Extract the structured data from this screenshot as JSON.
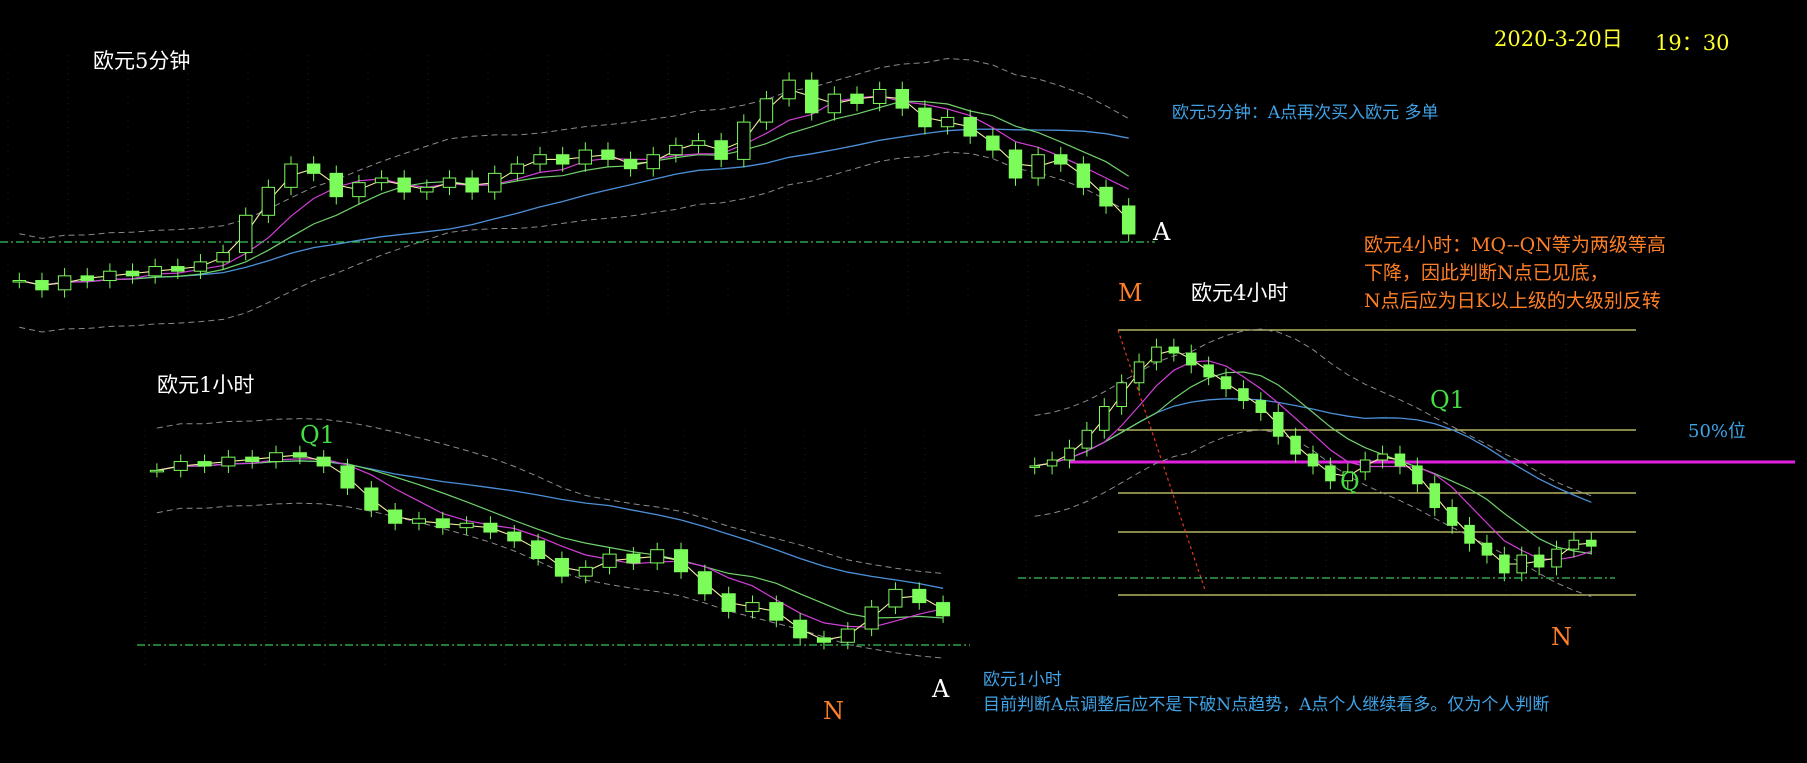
{
  "header": {
    "date": "2020-3-20日",
    "time": "19：30"
  },
  "panels": {
    "m5": {
      "title": "欧元5分钟",
      "note": "欧元5分钟：A点再次买入欧元 多单",
      "point_a": "A"
    },
    "h4": {
      "title": "欧元4小时",
      "note_lines": [
        "欧元4小时：MQ--QN等为两级等高",
        "下降，因此判断N点已见底，",
        "N点后应为日K以上级的大级别反转"
      ],
      "point_m": "M",
      "point_q1": "Q1",
      "point_q": "Q",
      "point_n": "N",
      "fib_label": "50%位"
    },
    "h1": {
      "title": "欧元1小时",
      "point_q1": "Q1",
      "point_n": "N",
      "point_a": "A",
      "note_title": "欧元1小时",
      "note_body": "目前判断A点调整后应不是下破N点趋势，A点个人继续看多。仅为个人判断"
    }
  },
  "colors": {
    "background": "#000000",
    "candle": "#7cfc5a",
    "ma_fast": "#f4f0a0",
    "ma_mid": "#d23ed8",
    "ma_slow": "#6fd06a",
    "ma_long": "#4a90d9",
    "band": "#8a8a8a",
    "support": "#39c45a",
    "fib": "#d8d878",
    "magenta_level": "#e020e0",
    "trend": "#e03a1a",
    "annotation_blue": "#3fa3e6",
    "annotation_orange": "#ff7f27",
    "timestamp": "#ffff2a"
  },
  "chart_data": [
    {
      "type": "candlestick",
      "title": "欧元5分钟",
      "trend_shape": "low start, rise, peak, sharp decline to point A",
      "closes": [
        1.06,
        1.058,
        1.061,
        1.06,
        1.062,
        1.061,
        1.063,
        1.062,
        1.064,
        1.066,
        1.074,
        1.08,
        1.085,
        1.083,
        1.078,
        1.081,
        1.082,
        1.079,
        1.08,
        1.082,
        1.079,
        1.083,
        1.085,
        1.087,
        1.085,
        1.088,
        1.086,
        1.084,
        1.087,
        1.089,
        1.09,
        1.086,
        1.094,
        1.099,
        1.103,
        1.096,
        1.1,
        1.098,
        1.101,
        1.097,
        1.093,
        1.095,
        1.091,
        1.088,
        1.082,
        1.087,
        1.085,
        1.08,
        1.076,
        1.07
      ],
      "annotation_points": [
        "A"
      ]
    },
    {
      "type": "candlestick",
      "title": "欧元4小时",
      "trend_shape": "peak at M, stepwise decline via Q1 and Q, bottom at N",
      "closes": [
        1.1,
        1.102,
        1.106,
        1.112,
        1.12,
        1.128,
        1.135,
        1.14,
        1.138,
        1.134,
        1.13,
        1.126,
        1.122,
        1.118,
        1.11,
        1.104,
        1.1,
        1.095,
        1.098,
        1.102,
        1.104,
        1.1,
        1.094,
        1.086,
        1.08,
        1.074,
        1.07,
        1.064,
        1.07,
        1.066,
        1.072,
        1.075,
        1.073
      ],
      "annotation_points": [
        "M",
        "Q1",
        "Q",
        "N"
      ],
      "reference_levels": [
        "50%位"
      ]
    },
    {
      "type": "candlestick",
      "title": "欧元1小时",
      "trend_shape": "flat near Q1, downtrend to N, rebound then dip to A",
      "closes": [
        1.094,
        1.096,
        1.095,
        1.097,
        1.096,
        1.098,
        1.097,
        1.095,
        1.09,
        1.085,
        1.082,
        1.083,
        1.081,
        1.082,
        1.08,
        1.078,
        1.074,
        1.07,
        1.072,
        1.075,
        1.073,
        1.076,
        1.071,
        1.066,
        1.062,
        1.064,
        1.06,
        1.056,
        1.055,
        1.058,
        1.063,
        1.067,
        1.064,
        1.061
      ],
      "annotation_points": [
        "Q1",
        "N",
        "A"
      ]
    }
  ]
}
